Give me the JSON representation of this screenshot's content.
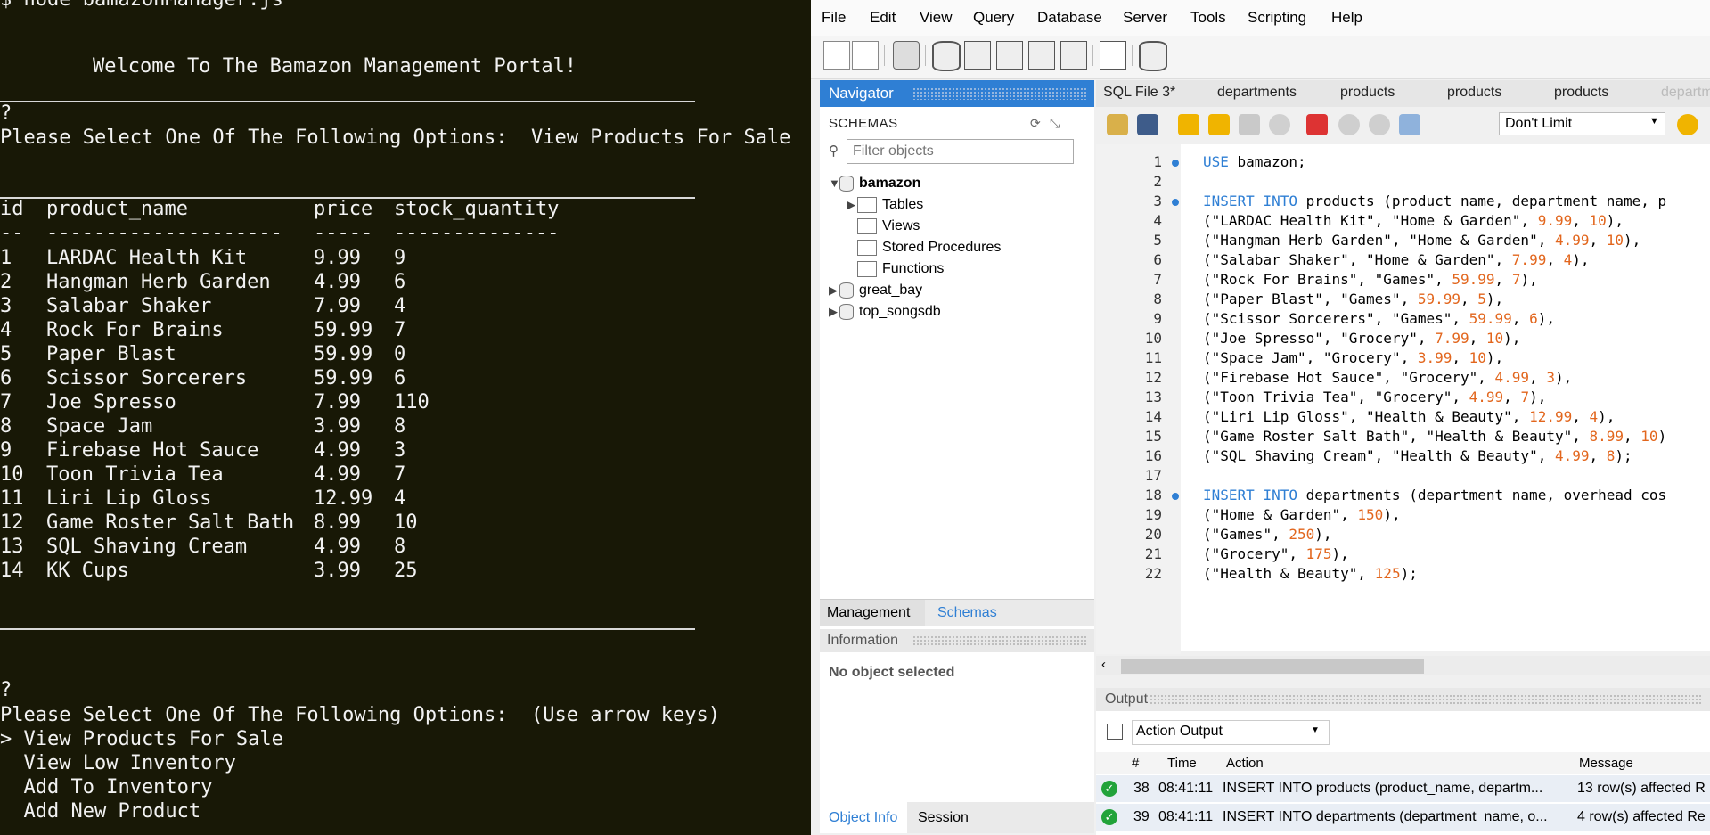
{
  "terminal": {
    "first_line": "$ node bamazonManager.js",
    "welcome": "Welcome To The Bamazon Management Portal!",
    "prompt1_q": "?",
    "prompt1": "Please Select One Of The Following Options:  View Products For Sale",
    "table_headers": [
      "id",
      "product_name",
      "price",
      "stock_quantity"
    ],
    "table_dashes": [
      "--",
      "--------------------",
      "-----",
      "--------------"
    ],
    "rows": [
      [
        "1",
        "LARDAC Health Kit",
        "9.99",
        "9"
      ],
      [
        "2",
        "Hangman Herb Garden",
        "4.99",
        "6"
      ],
      [
        "3",
        "Salabar Shaker",
        "7.99",
        "4"
      ],
      [
        "4",
        "Rock For Brains",
        "59.99",
        "7"
      ],
      [
        "5",
        "Paper Blast",
        "59.99",
        "0"
      ],
      [
        "6",
        "Scissor Sorcerers",
        "59.99",
        "6"
      ],
      [
        "7",
        "Joe Spresso",
        "7.99",
        "110"
      ],
      [
        "8",
        "Space Jam",
        "3.99",
        "8"
      ],
      [
        "9",
        "Firebase Hot Sauce",
        "4.99",
        "3"
      ],
      [
        "10",
        "Toon Trivia Tea",
        "4.99",
        "7"
      ],
      [
        "11",
        "Liri Lip Gloss",
        "12.99",
        "4"
      ],
      [
        "12",
        "Game Roster Salt Bath",
        "8.99",
        "10"
      ],
      [
        "13",
        "SQL Shaving Cream",
        "4.99",
        "8"
      ],
      [
        "14",
        "KK Cups",
        "3.99",
        "25"
      ]
    ],
    "prompt2_q": "?",
    "prompt2": "Please Select One Of The Following Options:  (Use arrow keys)",
    "options": [
      "> View Products For Sale",
      "  View Low Inventory",
      "  Add To Inventory",
      "  Add New Product"
    ]
  },
  "workbench": {
    "menu": [
      "File",
      "Edit",
      "View",
      "Query",
      "Database",
      "Server",
      "Tools",
      "Scripting",
      "Help"
    ],
    "navigator": {
      "title": "Navigator",
      "schemas_label": "SCHEMAS",
      "filter_placeholder": "Filter objects",
      "schemas": [
        "bamazon",
        "great_bay",
        "top_songsdb"
      ],
      "bamazon_children": [
        "Tables",
        "Views",
        "Stored Procedures",
        "Functions"
      ],
      "tabs": [
        "Management",
        "Schemas"
      ],
      "info_title": "Information",
      "info_text": "No object selected",
      "bottom_tabs": [
        "Object Info",
        "Session"
      ]
    },
    "doc_tabs": [
      "SQL File 3*",
      "departments",
      "products",
      "products",
      "products",
      "departmen"
    ],
    "limit": "Don't Limit",
    "output": {
      "title": "Output",
      "select": "Action Output",
      "columns": [
        "#",
        "Time",
        "Action",
        "Message"
      ],
      "rows": [
        {
          "num": "38",
          "time": "08:41:11",
          "action": "INSERT INTO products (product_name, departm...",
          "message": "13 row(s) affected R"
        },
        {
          "num": "39",
          "time": "08:41:11",
          "action": "INSERT INTO departments (department_name, o...",
          "message": "4 row(s) affected Re"
        }
      ]
    },
    "code_lines": [
      {
        "n": "1",
        "dot": true,
        "text": "USE bamazon;"
      },
      {
        "n": "2",
        "dot": false,
        "text": ""
      },
      {
        "n": "3",
        "dot": true,
        "text": "INSERT INTO products (product_name, department_name, p"
      },
      {
        "n": "4",
        "dot": false,
        "text": "(\"LARDAC Health Kit\", \"Home & Garden\", 9.99, 10),"
      },
      {
        "n": "5",
        "dot": false,
        "text": "(\"Hangman Herb Garden\", \"Home & Garden\", 4.99, 10),"
      },
      {
        "n": "6",
        "dot": false,
        "text": "(\"Salabar Shaker\", \"Home & Garden\", 7.99, 4),"
      },
      {
        "n": "7",
        "dot": false,
        "text": "(\"Rock For Brains\", \"Games\", 59.99, 7),"
      },
      {
        "n": "8",
        "dot": false,
        "text": "(\"Paper Blast\", \"Games\", 59.99, 5),"
      },
      {
        "n": "9",
        "dot": false,
        "text": "(\"Scissor Sorcerers\", \"Games\", 59.99, 6),"
      },
      {
        "n": "10",
        "dot": false,
        "text": "(\"Joe Spresso\", \"Grocery\", 7.99, 10),"
      },
      {
        "n": "11",
        "dot": false,
        "text": "(\"Space Jam\", \"Grocery\", 3.99, 10),"
      },
      {
        "n": "12",
        "dot": false,
        "text": "(\"Firebase Hot Sauce\", \"Grocery\", 4.99, 3),"
      },
      {
        "n": "13",
        "dot": false,
        "text": "(\"Toon Trivia Tea\", \"Grocery\", 4.99, 7),"
      },
      {
        "n": "14",
        "dot": false,
        "text": "(\"Liri Lip Gloss\", \"Health & Beauty\", 12.99, 4),"
      },
      {
        "n": "15",
        "dot": false,
        "text": "(\"Game Roster Salt Bath\", \"Health & Beauty\", 8.99, 10)"
      },
      {
        "n": "16",
        "dot": false,
        "text": "(\"SQL Shaving Cream\", \"Health & Beauty\", 4.99, 8);"
      },
      {
        "n": "17",
        "dot": false,
        "text": ""
      },
      {
        "n": "18",
        "dot": true,
        "text": "INSERT INTO departments (department_name, overhead_cos"
      },
      {
        "n": "19",
        "dot": false,
        "text": "(\"Home & Garden\", 150),"
      },
      {
        "n": "20",
        "dot": false,
        "text": "(\"Games\", 250),"
      },
      {
        "n": "21",
        "dot": false,
        "text": "(\"Grocery\", 175),"
      },
      {
        "n": "22",
        "dot": false,
        "text": "(\"Health & Beauty\", 125);"
      }
    ]
  }
}
